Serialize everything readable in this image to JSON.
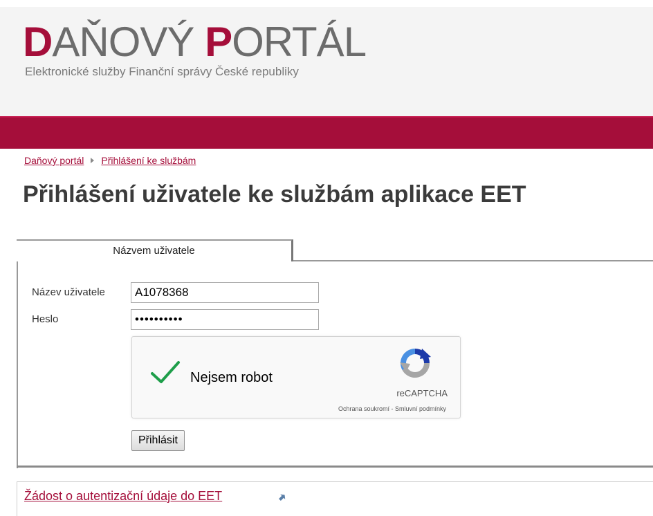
{
  "header": {
    "logo": {
      "word1_initial": "D",
      "word1_rest": "AŇOVÝ ",
      "word2_initial": "P",
      "word2_rest": "ORTÁL"
    },
    "tagline": "Elektronické služby Finanční správy České republiky"
  },
  "breadcrumb": {
    "items": [
      {
        "label": "Daňový portál"
      },
      {
        "label": "Přihlášení ke službám"
      }
    ]
  },
  "page_title": "Přihlášení uživatele ke službám aplikace EET",
  "login": {
    "tab_label": "Názvem uživatele",
    "username_label": "Název uživatele",
    "username_value": "A1078368",
    "password_label": "Heslo",
    "password_value": "••••••••••",
    "captcha": {
      "label": "Nejsem robot",
      "brand": "reCAPTCHA",
      "links": "Ochrana soukromí - Smluvní podmínky",
      "checked": true
    },
    "submit_label": "Přihlásit"
  },
  "footer": {
    "link_label": "Žádost o autentizační údaje do EET"
  },
  "colors": {
    "brand": "#a50e3a",
    "check": "#1e9e4a",
    "recaptcha_blue": "#1c3aa9",
    "recaptcha_grey": "#a6a6a6"
  }
}
